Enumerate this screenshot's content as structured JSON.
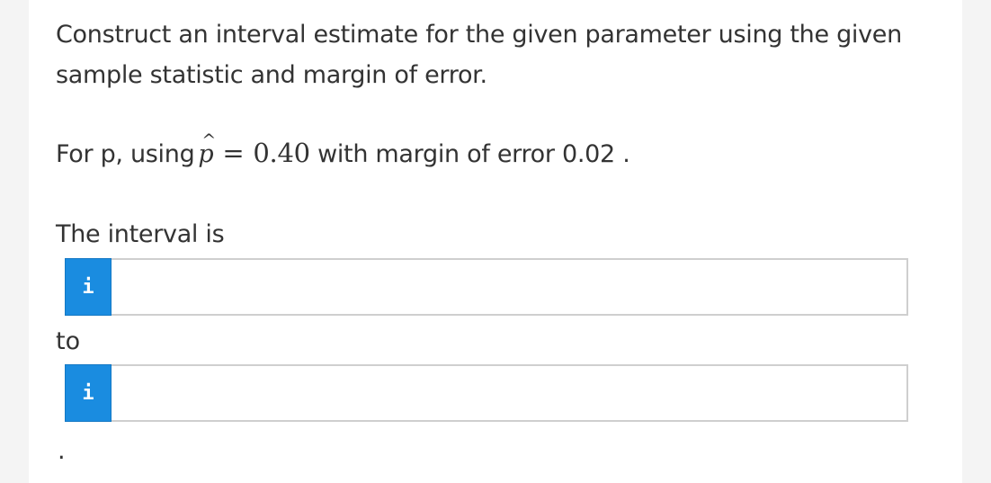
{
  "question": {
    "prompt": "Construct an interval estimate for the given parameter using the given sample statistic and margin of error.",
    "setup_prefix": "For p, using",
    "phat_symbol": "p",
    "hat_symbol": "^",
    "equals": "=",
    "phat_value": "0.40",
    "setup_suffix": "with margin of error 0.02 ."
  },
  "answer": {
    "interval_label": "The interval is",
    "to_label": "to",
    "trailing_period": ".",
    "info_button_label": "i",
    "lower_value": "",
    "upper_value": ""
  },
  "colors": {
    "info_button": "#1a8ce0",
    "text": "#333333",
    "page_background": "#f4f4f4"
  }
}
